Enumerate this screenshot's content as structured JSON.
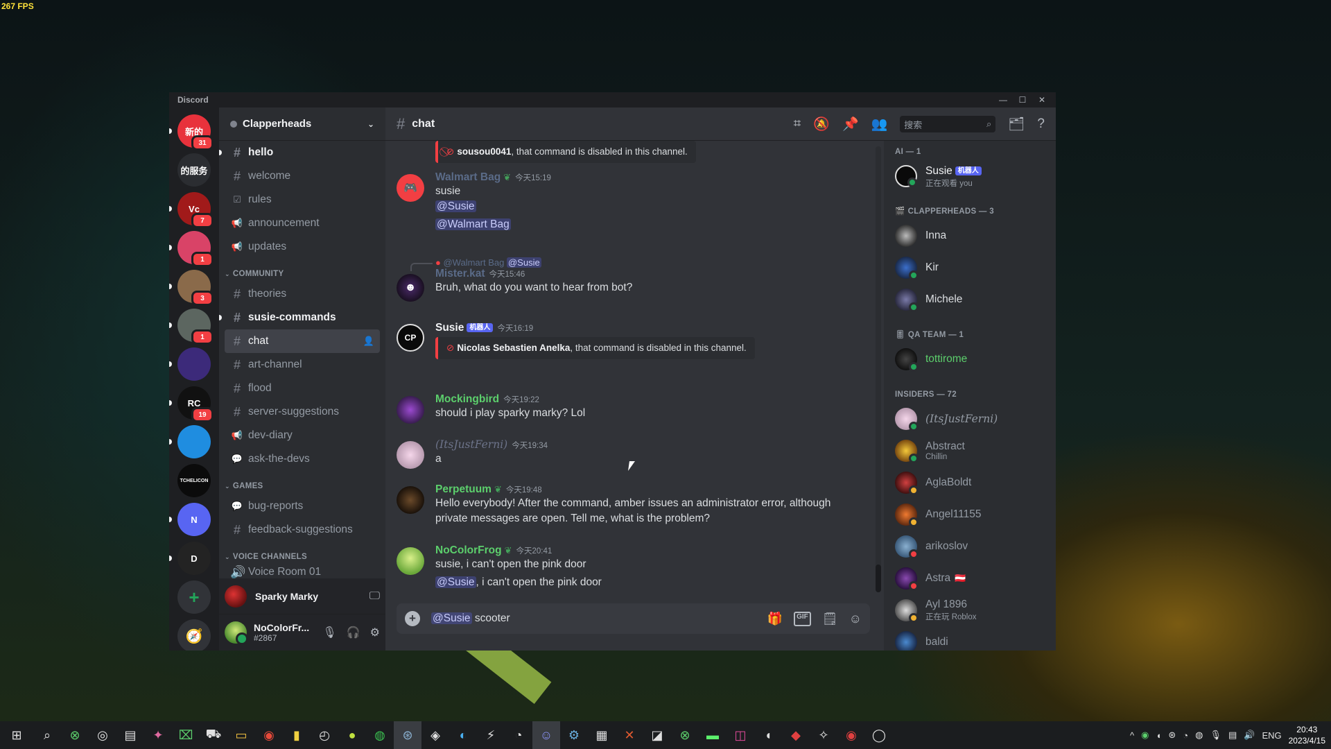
{
  "overlay": {
    "fps": "267 FPS"
  },
  "window": {
    "app_name": "Discord"
  },
  "guilds": [
    {
      "label": "新的",
      "badge": "31",
      "color": "#e8323c"
    },
    {
      "label": "的服务",
      "badge": "",
      "color": "#2b2d31"
    },
    {
      "label": "Vc",
      "badge": "7",
      "color": "#a11a1a"
    },
    {
      "label": "",
      "badge": "1",
      "color": "#d94367"
    },
    {
      "label": "",
      "badge": "3",
      "color": "#8a6a4a"
    },
    {
      "label": "",
      "badge": "1",
      "color": "#5c6660"
    },
    {
      "label": "",
      "badge": "",
      "color": "#3c2a7a"
    },
    {
      "label": "RC",
      "badge": "19",
      "color": "#111111"
    },
    {
      "label": "",
      "badge": "",
      "color": "#1f8de0"
    },
    {
      "label": "TCHELICON",
      "badge": "",
      "color": "#0b0b0b"
    },
    {
      "label": "N",
      "badge": "",
      "color": "#5865f2"
    },
    {
      "label": "D",
      "badge": "",
      "color": "#232323"
    }
  ],
  "server": {
    "name": "Clapperheads"
  },
  "channels": [
    {
      "type": "text",
      "name": "hello",
      "unread": true
    },
    {
      "type": "text",
      "name": "welcome",
      "unread": false
    },
    {
      "type": "rules",
      "name": "rules",
      "unread": false
    },
    {
      "type": "announce",
      "name": "announcement",
      "unread": false
    },
    {
      "type": "announce",
      "name": "updates",
      "unread": false
    }
  ],
  "categories": {
    "community": "COMMUNITY",
    "games": "GAMES",
    "voice": "VOICE CHANNELS"
  },
  "community_channels": [
    {
      "type": "text",
      "name": "theories",
      "unread": false
    },
    {
      "type": "text",
      "name": "susie-commands",
      "unread": true
    },
    {
      "type": "text",
      "name": "chat",
      "active": true
    },
    {
      "type": "text",
      "name": "art-channel",
      "unread": false
    },
    {
      "type": "text",
      "name": "flood",
      "unread": false
    },
    {
      "type": "text",
      "name": "server-suggestions",
      "unread": false
    },
    {
      "type": "announce",
      "name": "dev-diary",
      "unread": false
    },
    {
      "type": "forum",
      "name": "ask-the-devs",
      "unread": false
    }
  ],
  "games_channels": [
    {
      "type": "forum",
      "name": "bug-reports"
    },
    {
      "type": "text",
      "name": "feedback-suggestions"
    }
  ],
  "voice_partial": "Voice Room 01",
  "voice_user": {
    "name": "Sparky Marky"
  },
  "current_user": {
    "name": "NoColorFr...",
    "tag": "#2867"
  },
  "header": {
    "channel": "chat",
    "search_placeholder": "搜索"
  },
  "messages": {
    "m0": {
      "user": "sousou0041",
      "text": ", that command is disabled in this channel."
    },
    "m1": {
      "user": "Walmart Bag",
      "time": "今天15:19",
      "lines": [
        "susie"
      ],
      "mentions": [
        "@Susie",
        "@Walmart Bag"
      ]
    },
    "m2": {
      "reply_user": "@Walmart Bag",
      "reply_mention": "@Susie",
      "user": "Mister.kat",
      "time": "今天15:46",
      "text": "Bruh, what do you want to hear from bot?"
    },
    "m3": {
      "user": "Susie",
      "bot": "机器人",
      "time": "今天16:19",
      "embed_user": "Nicolas Sebastien Anelka",
      "embed_text": ", that command is disabled in this channel."
    },
    "m4": {
      "user": "Mockingbird",
      "time": "今天19:22",
      "text": "should i play sparky marky? Lol"
    },
    "m5": {
      "user": "(ItsJustFerni)",
      "time": "今天19:34",
      "text": "a"
    },
    "m6": {
      "user": "Perpetuum",
      "time": "今天19:48",
      "text": "Hello everybody! After the command, amber issues an administrator error, although private messages are open. Tell me, what is the problem?"
    },
    "m7": {
      "user": "NoColorFrog",
      "time": "今天20:41",
      "line1": "susie, i can't open the pink door",
      "mention": "@Susie",
      "line2": ", i can't open the pink door"
    }
  },
  "composer": {
    "mention": "@Susie",
    "text": "scooter"
  },
  "member_groups": {
    "ai": "AI — 1",
    "clapper": "CLAPPERHEADS — 3",
    "qa": "QA TEAM — 1",
    "insiders": "INSIDERS — 72"
  },
  "members": {
    "susie": {
      "name": "Susie",
      "bot": "机器人",
      "sub": "正在观看 you"
    },
    "inna": {
      "name": "Inna"
    },
    "kir": {
      "name": "Kir"
    },
    "michele": {
      "name": "Michele"
    },
    "tottirome": {
      "name": "tottirome"
    },
    "ferni": {
      "name": "(ItsJustFerni)"
    },
    "abstract": {
      "name": "Abstract",
      "sub": "Chillin"
    },
    "aglaboldt": {
      "name": "AglaBoldt"
    },
    "angel": {
      "name": "Angel11155"
    },
    "arikoslov": {
      "name": "arikoslov"
    },
    "astra": {
      "name": "Astra"
    },
    "ayl": {
      "name": "Ayl 1896",
      "sub": "正在玩 Roblox"
    },
    "baldi": {
      "name": "baldi"
    }
  },
  "tray": {
    "lang": "ENG",
    "time": "20:43",
    "date": "2023/4/15"
  },
  "colors": {
    "accent": "#5865f2",
    "online": "#23a55a",
    "idle": "#f0b232",
    "dnd": "#f23f43",
    "danger": "#f23f43"
  }
}
